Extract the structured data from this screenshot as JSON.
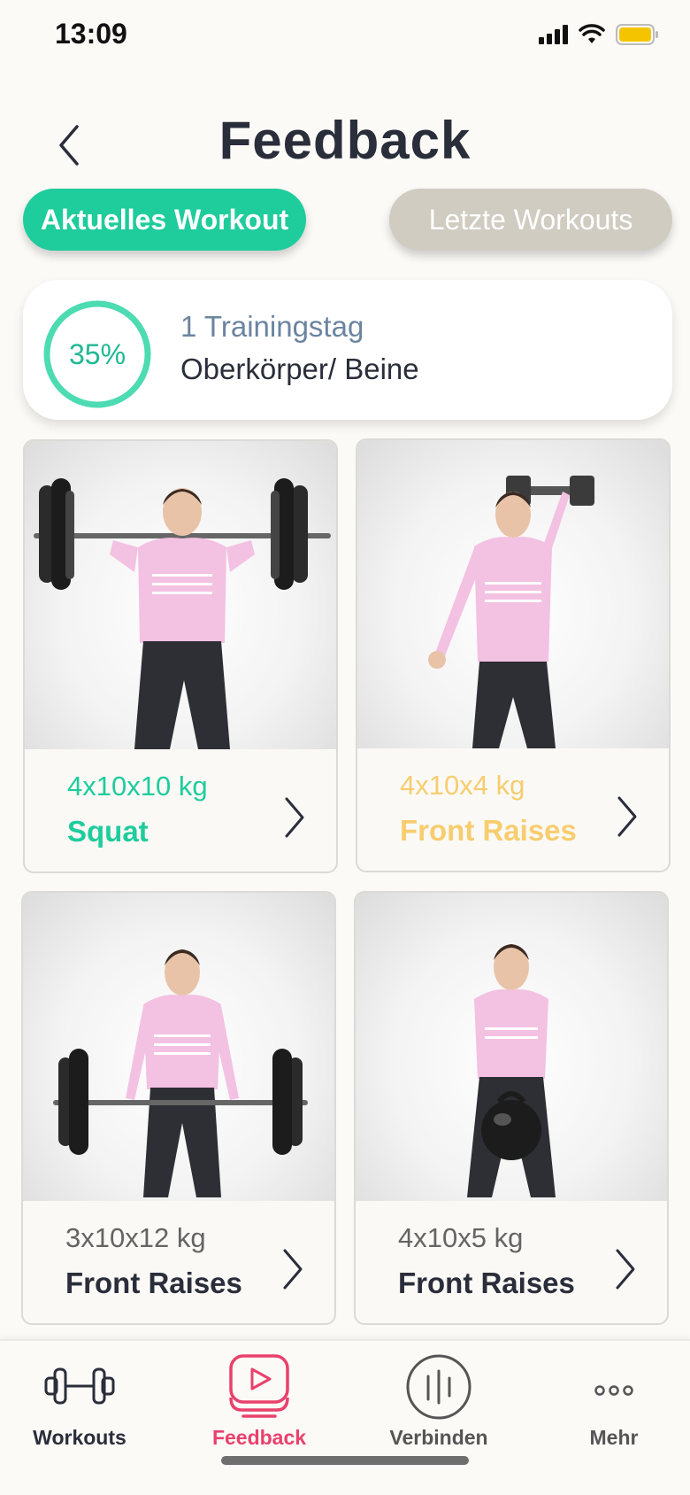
{
  "status_bar": {
    "time": "13:09",
    "icons": [
      "signal-icon",
      "wifi-icon",
      "battery-icon"
    ]
  },
  "header": {
    "title": "Feedback",
    "back_icon": "chevron-left-icon"
  },
  "tabs": [
    {
      "label": "Aktuelles Workout",
      "active": true
    },
    {
      "label": "Letzte Workouts",
      "active": false
    }
  ],
  "summary": {
    "progress_label": "35%",
    "progress": 0.35,
    "day": "1 Trainingstag",
    "name": "Oberkörper/ Beine"
  },
  "exercises": [
    {
      "sets": "4x10x10 kg",
      "name": "Squat",
      "color": "#1fcc9c",
      "figure": "barbell-squat"
    },
    {
      "sets": "4x10x4 kg",
      "name": "Front Raises",
      "color": "#f7cd6e",
      "figure": "dumbbell-raise"
    },
    {
      "sets": "3x10x12 kg",
      "name": "Front Raises",
      "color": "#2a2d3a",
      "figure": "barbell-deadlift"
    },
    {
      "sets": "4x10x5 kg",
      "name": "Front Raises",
      "color": "#2a2d3a",
      "figure": "kettlebell"
    }
  ],
  "nav": [
    {
      "label": "Workouts",
      "icon": "dumbbell-icon",
      "active": false
    },
    {
      "label": "Feedback",
      "icon": "play-icon",
      "active": true
    },
    {
      "label": "Verbinden",
      "icon": "connect-icon",
      "active": false
    },
    {
      "label": "Mehr",
      "icon": "more-icon",
      "active": false
    }
  ],
  "colors": {
    "accent": "#1fcc9c",
    "warning": "#f7cd6e",
    "active_nav": "#e8416c",
    "background": "#fcfaf7"
  }
}
